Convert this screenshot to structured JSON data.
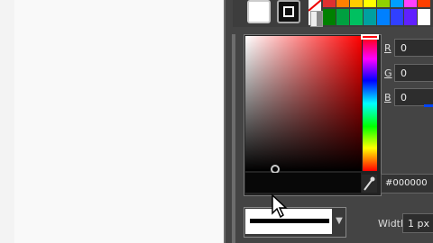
{
  "color_picker": {
    "hex_value": "#000000",
    "hue_position": 0.0,
    "r_label": "R",
    "g_label": "G",
    "b_label": "B",
    "r_value": "0",
    "g_value": "0",
    "b_value": "0"
  },
  "stroke": {
    "width_label": "Width",
    "width_value": "1 px"
  },
  "palette": [
    "#e03030",
    "#ff8000",
    "#ffcc00",
    "#ffff00",
    "#90d000",
    "#00a0ff",
    "#ff40ff",
    "#ff4000"
  ],
  "palette_bottom": [
    "#008000",
    "#00a040",
    "#00c060",
    "#00a0a0",
    "#0080ff",
    "#3040ff",
    "#6020ff",
    "#ffffff"
  ]
}
